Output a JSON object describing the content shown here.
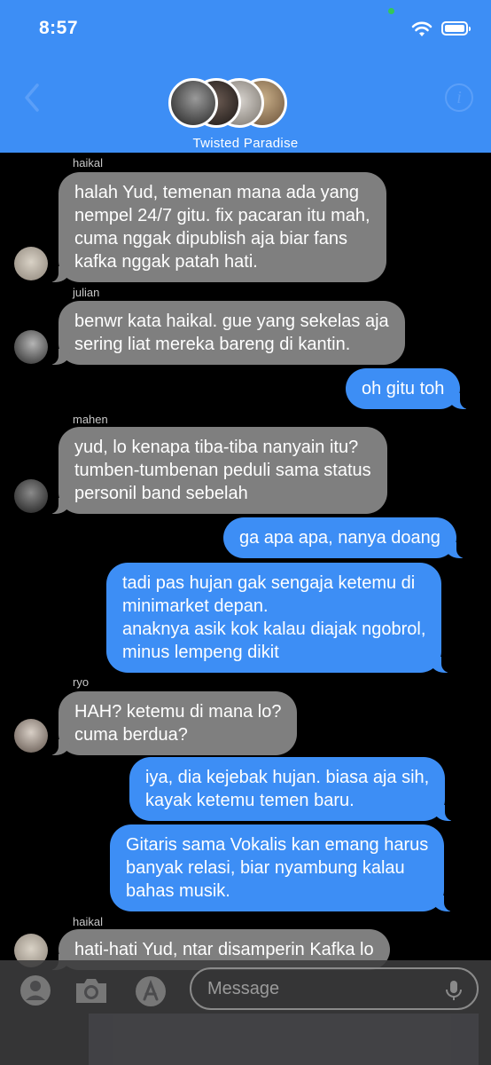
{
  "status_bar": {
    "time": "8:57"
  },
  "header": {
    "group_name": "Twisted Paradise"
  },
  "messages": [
    {
      "sender": "haikal",
      "text": "halah Yud, temenan mana ada yang\nnempel 24/7 gitu. fix pacaran itu mah,\ncuma nggak dipublish aja biar fans\nkafka nggak patah hati."
    },
    {
      "sender": "julian",
      "text": "benwr kata haikal. gue yang sekelas aja\nsering liat mereka bareng di kantin."
    },
    {
      "sender": "",
      "text": "oh gitu toh"
    },
    {
      "sender": "mahen",
      "text": "yud, lo kenapa tiba-tiba nanyain itu?\ntumben-tumbenan peduli sama status\npersonil band sebelah"
    },
    {
      "sender": "",
      "text": "ga apa apa, nanya doang"
    },
    {
      "sender": "",
      "text": "tadi pas hujan gak sengaja ketemu di\nminimarket depan.\nanaknya asik kok kalau diajak ngobrol,\nminus lempeng dikit"
    },
    {
      "sender": "ryo",
      "text": "HAH? ketemu di mana lo?\ncuma berdua?"
    },
    {
      "sender": "",
      "text": "iya, dia kejebak hujan. biasa aja sih,\nkayak ketemu temen baru."
    },
    {
      "sender": "",
      "text": "Gitaris sama Vokalis kan emang harus\nbanyak relasi, biar nyambung kalau\nbahas musik."
    },
    {
      "sender": "haikal",
      "text": "hati-hati Yud, ntar disamperin Kafka lo"
    }
  ],
  "input": {
    "placeholder": "Message"
  },
  "colors": {
    "accent": "#3d8ef5",
    "incoming_bubble": "#7f7f7f",
    "background": "#000000"
  }
}
